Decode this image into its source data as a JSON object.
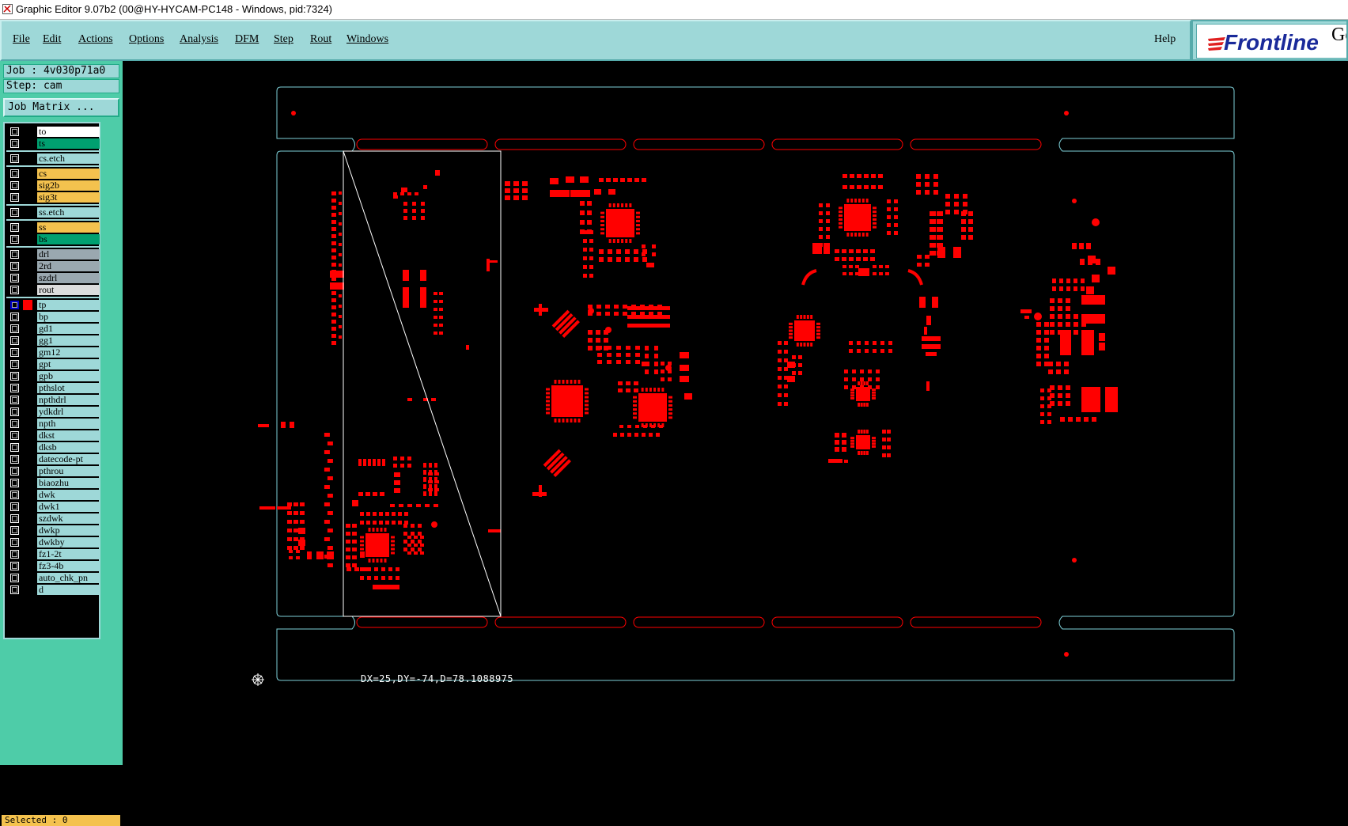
{
  "window": {
    "title": "Graphic Editor 9.07b2 (00@HY-HYCAM-PC148 - Windows, pid:7324)"
  },
  "menu": {
    "items": [
      {
        "label": "File"
      },
      {
        "label": "Edit"
      },
      {
        "label": "Actions"
      },
      {
        "label": "Options"
      },
      {
        "label": "Analysis"
      },
      {
        "label": "DFM"
      },
      {
        "label": "Step"
      },
      {
        "label": "Rout"
      },
      {
        "label": "Windows"
      }
    ],
    "help": "Help"
  },
  "logo": {
    "brand": "Frontline",
    "suffix": "Ge"
  },
  "info": {
    "job": "Job : 4v030p71a0",
    "step": "Step: cam",
    "job_matrix": "Job Matrix ..."
  },
  "colors": {
    "panel": "#9ed8d8",
    "sidebar": "#4ecca8",
    "copper": "#ff0000",
    "outline": "#7ed0d8",
    "white_layer": "#ffffff",
    "green_layer": "#00a070",
    "yellow_layer": "#f4c24e",
    "grey_layer": "#9aa8b0"
  },
  "layers": [
    {
      "name": "to",
      "color": "#ffffff"
    },
    {
      "name": "ts",
      "color": "#00a070"
    },
    {
      "name": "cs.etch",
      "color": "#9ed8d8"
    },
    {
      "name": "cs",
      "color": "#f4c24e"
    },
    {
      "name": "sig2b",
      "color": "#f4c24e"
    },
    {
      "name": "sig3t",
      "color": "#f4c24e"
    },
    {
      "name": "ss.etch",
      "color": "#9ed8d8"
    },
    {
      "name": "ss",
      "color": "#f4c24e"
    },
    {
      "name": "bs",
      "color": "#00a070"
    },
    {
      "name": "drl",
      "color": "#9aa8b0"
    },
    {
      "name": "2rd",
      "color": "#9aa8b0"
    },
    {
      "name": "szdrl",
      "color": "#9aa8b0"
    },
    {
      "name": "rout",
      "color": "#dcdcdc"
    },
    {
      "name": "tp",
      "color": "#9ed8d8",
      "active": true
    },
    {
      "name": "bp",
      "color": "#9ed8d8"
    },
    {
      "name": "gd1",
      "color": "#9ed8d8"
    },
    {
      "name": "gg1",
      "color": "#9ed8d8"
    },
    {
      "name": "gm12",
      "color": "#9ed8d8"
    },
    {
      "name": "gpt",
      "color": "#9ed8d8"
    },
    {
      "name": "gpb",
      "color": "#9ed8d8"
    },
    {
      "name": "pthslot",
      "color": "#9ed8d8"
    },
    {
      "name": "npthdrl",
      "color": "#9ed8d8"
    },
    {
      "name": "ydkdrl",
      "color": "#9ed8d8"
    },
    {
      "name": "npth",
      "color": "#9ed8d8"
    },
    {
      "name": "dkst",
      "color": "#9ed8d8"
    },
    {
      "name": "dksb",
      "color": "#9ed8d8"
    },
    {
      "name": "datecode-pt",
      "color": "#9ed8d8"
    },
    {
      "name": "pthrou",
      "color": "#9ed8d8"
    },
    {
      "name": "biaozhu",
      "color": "#9ed8d8"
    },
    {
      "name": "dwk",
      "color": "#9ed8d8"
    },
    {
      "name": "dwk1",
      "color": "#9ed8d8"
    },
    {
      "name": "szdwk",
      "color": "#9ed8d8"
    },
    {
      "name": "dwkp",
      "color": "#9ed8d8"
    },
    {
      "name": "dwkby",
      "color": "#9ed8d8"
    },
    {
      "name": "fz1-2t",
      "color": "#9ed8d8"
    },
    {
      "name": "fz3-4b",
      "color": "#9ed8d8"
    },
    {
      "name": "auto_chk_pn",
      "color": "#9ed8d8"
    },
    {
      "name": "d",
      "color": "#9ed8d8"
    }
  ],
  "status": {
    "selected": "Selected : 0"
  },
  "measure": {
    "text": "DX=25,DY=-74,D=78.1088975"
  }
}
